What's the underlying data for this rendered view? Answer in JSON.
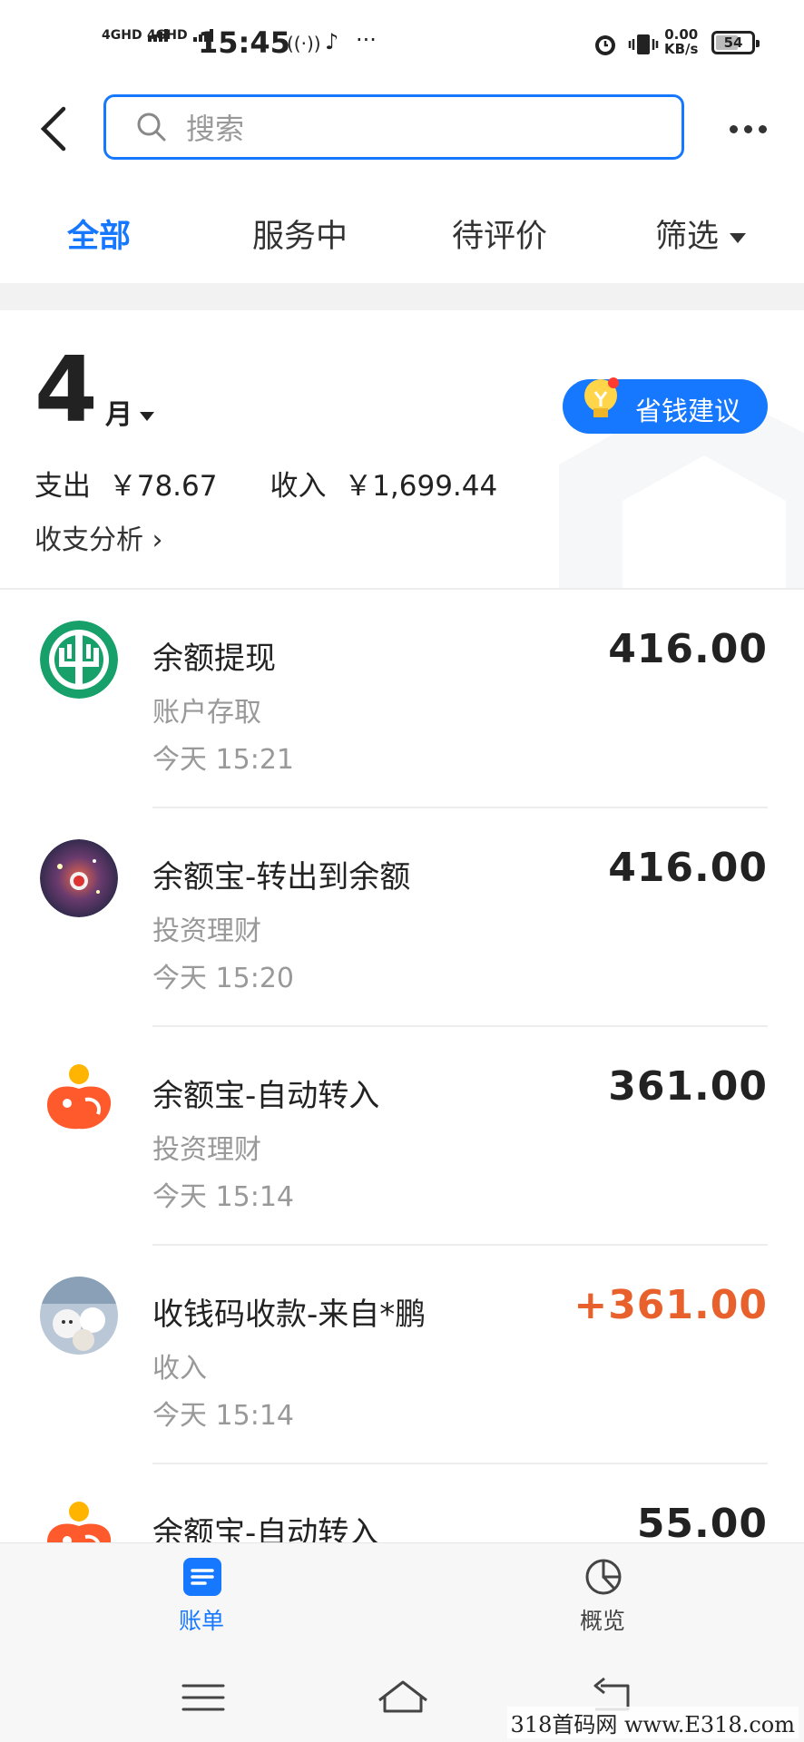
{
  "status_bar": {
    "network1": "4GHD",
    "network2": "4GHD",
    "time": "15:45",
    "speed_value": "0.00",
    "speed_unit": "KB/s",
    "battery": "54"
  },
  "header": {
    "search_placeholder": "搜索"
  },
  "tabs": [
    {
      "label": "全部",
      "active": true
    },
    {
      "label": "服务中"
    },
    {
      "label": "待评价"
    },
    {
      "label": "筛选"
    }
  ],
  "summary": {
    "month_number": "4",
    "month_unit": "月",
    "save_tip": "省钱建议",
    "expense_label": "支出",
    "expense_value": "￥78.67",
    "income_label": "收入",
    "income_value": "￥1,699.44",
    "analysis_link": "收支分析 ›"
  },
  "transactions": [
    {
      "title": "余额提现",
      "category": "账户存取",
      "time": "今天  15:21",
      "amount": "416.00",
      "avatar": "bank-logo-icon"
    },
    {
      "title": "余额宝-转出到余额",
      "category": "投资理财",
      "time": "今天  15:20",
      "amount": "416.00",
      "avatar": "user-avatar-photo"
    },
    {
      "title": "余额宝-自动转入",
      "category": "投资理财",
      "time": "今天  15:14",
      "amount": "361.00",
      "avatar": "yuebao-logo-icon"
    },
    {
      "title": "收钱码收款-来自*鹏",
      "category": "收入",
      "time": "今天  15:14",
      "amount": "+361.00",
      "avatar": "user-avatar-photo",
      "income": true
    },
    {
      "title": "余额宝-自动转入",
      "category": "",
      "time": "",
      "amount": "55.00",
      "avatar": "yuebao-logo-icon"
    }
  ],
  "bottom_nav": {
    "bill": "账单",
    "overview": "概览"
  },
  "watermark": "318首码网  www.E318.com",
  "colors": {
    "accent": "#1677ff",
    "income": "#e8612c",
    "bank_green": "#17a06a",
    "yuebao_orange": "#ff5a2c"
  }
}
